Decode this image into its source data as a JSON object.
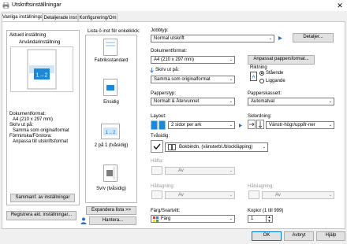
{
  "window": {
    "title": "Utskriftsinställningar",
    "close_glyph": "✕"
  },
  "tabs": [
    {
      "label": "Vanliga inställningar"
    },
    {
      "label": "Detaljerade inst"
    },
    {
      "label": "Konfigurering/Om"
    }
  ],
  "current_setting": {
    "group_label": "Aktuell inställning",
    "name": "Användarinställning",
    "preview_text": "1→2",
    "summary": [
      "Dokumentformat:",
      "  A4 (210 x 297 mm)",
      "Skriv ut på:",
      "  Samma som originalformat",
      "Förminska/Förstora:",
      "  Anpassa till utskriftsformat"
    ],
    "summary_button": "Sammanf. av inställningar",
    "register_button": "Registrera akt. inställningar..."
  },
  "one_click": {
    "header": "Lista ö inst för enkelklick:",
    "items": [
      {
        "label": "Fabriksstandard"
      },
      {
        "label": "Ensidig"
      },
      {
        "label": "2 på 1 (tvåsidig)",
        "preview_text": "1→2"
      },
      {
        "label": "Sv/v (tvåsidig)"
      }
    ],
    "expand_button": "Expandera lista >>",
    "manage_button": "Hantera..."
  },
  "job": {
    "job_type_label": "Jobbtyp:",
    "job_type_value": "Normal utskrift",
    "details_button": "Detaljer...",
    "doc_size_label": "Dokumentformat:",
    "doc_size_value": "A4 (210 x 297 mm)",
    "custom_size_button": "Anpassat pappersformat...",
    "print_on_label": "Skriv ut på:",
    "print_on_value": "Samma som originalformat",
    "orientation_label": "Riktning",
    "orientation_options": [
      {
        "label": "Stående",
        "selected": true
      },
      {
        "label": "Liggande",
        "selected": false
      }
    ],
    "paper_type_label": "Papperstyp:",
    "paper_type_value": "Normalt & Återvunnet",
    "tray_label": "Papperskassett:",
    "tray_value": "Automatval",
    "layout_label": "Layout:",
    "layout_value": "2 sidor per ark",
    "page_order_label": "Sidordning:",
    "page_order_value": "Vänstr-högr/uppifr-ner",
    "duplex_label": "Tvåsidig:",
    "duplex_value": "Bokbindn. (vänsterbl./blockläpping)",
    "staple_label": "Häfta:",
    "staple_value": "Av",
    "punch_label": "Håltagning:",
    "punch_value": "Av",
    "hole_label": "Hålslagning:",
    "hole_value": "Av",
    "color_label": "Färg/Svartvitt:",
    "color_value": "Färg",
    "copies_label": "Kopior (1 till 999)",
    "copies_value": "1"
  },
  "dialog_buttons": {
    "ok": "OK",
    "cancel": "Avbryt",
    "help": "Hjälp"
  }
}
